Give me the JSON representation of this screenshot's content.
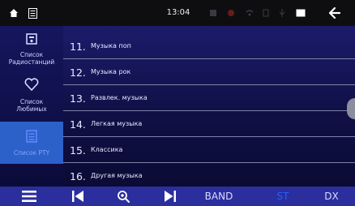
{
  "status_bar": {
    "time": "13:04",
    "icons": [
      "home-icon",
      "menu-icon",
      "app-icon",
      "notification-icon",
      "wifi-icon",
      "battery-icon",
      "usb-icon",
      "screen-icon",
      "back-icon"
    ]
  },
  "sidebar": {
    "items": [
      {
        "label": "Список\nРадиостанций",
        "icon": "radio-list-icon",
        "active": false
      },
      {
        "label": "Список\nЛюбимых",
        "icon": "heart-icon",
        "active": false
      },
      {
        "label": "Список PTY",
        "icon": "pty-list-icon",
        "active": true
      }
    ]
  },
  "list": {
    "rows": [
      {
        "num": "11.",
        "title": "Музыка поп"
      },
      {
        "num": "12.",
        "title": "Музыка рок"
      },
      {
        "num": "13.",
        "title": "Развлек. музыка"
      },
      {
        "num": "14.",
        "title": "Легкая музыка"
      },
      {
        "num": "15.",
        "title": "Классика"
      },
      {
        "num": "16.",
        "title": "Другая музыка"
      }
    ]
  },
  "bottom_bar": {
    "band": "BAND",
    "st": "ST",
    "dx": "DX"
  },
  "colors": {
    "accent": "#2c61c9",
    "active_text": "#1f62ff"
  }
}
